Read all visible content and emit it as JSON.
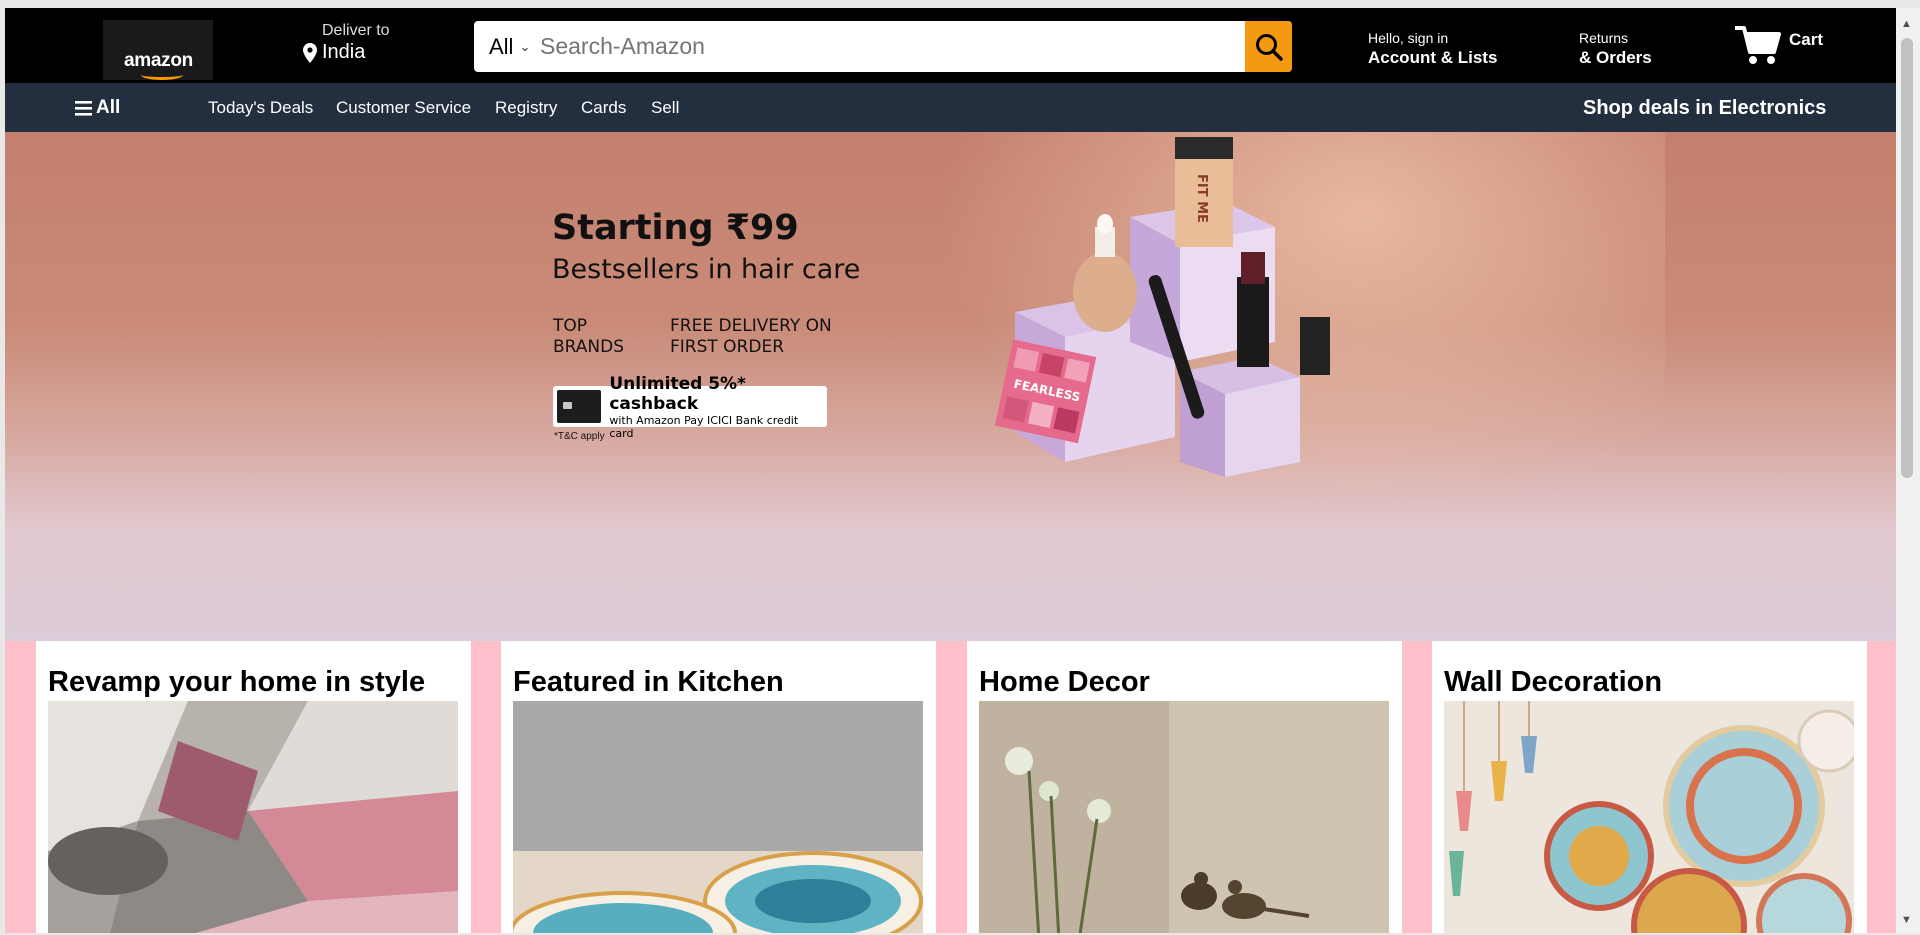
{
  "header": {
    "logo": "amazon",
    "deliver_to_label": "Deliver to",
    "deliver_to_location": "India",
    "search_dept": "All",
    "search_placeholder": "Search-Amazon",
    "account_line1": "Hello, sign in",
    "account_line2": "Account & Lists",
    "returns_line1": "Returns",
    "returns_line2": "& Orders",
    "cart_label": "Cart",
    "accent_color": "#f39a12"
  },
  "subnav": {
    "all_label": "All",
    "links": [
      "Today's Deals",
      "Customer Service",
      "Registry",
      "Cards",
      "Sell"
    ],
    "promo": "Shop deals in Electronics"
  },
  "hero": {
    "headline": "Starting ₹99",
    "subheadline": "Bestsellers in hair care",
    "feature_1": "TOP BRANDS",
    "feature_2": "FREE DELIVERY ON FIRST ORDER",
    "cashback_title": "Unlimited 5%* cashback",
    "cashback_sub": "with Amazon Pay ICICI Bank credit card",
    "terms": "*T&C apply",
    "palette_text": "FEARLESS",
    "fitme_text": "FIT ME"
  },
  "cards": [
    {
      "title": "Revamp your home in style"
    },
    {
      "title": "Featured in Kitchen"
    },
    {
      "title": "Home Decor"
    },
    {
      "title": "Wall Decoration"
    }
  ]
}
